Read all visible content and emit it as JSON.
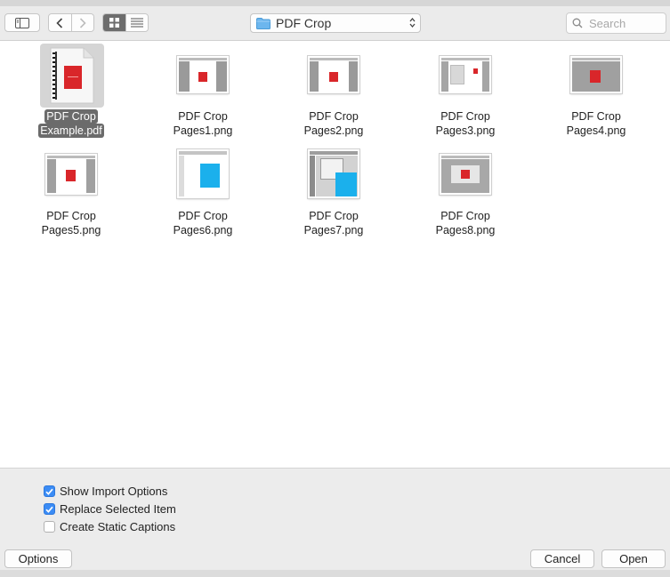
{
  "toolbar": {
    "path_folder": "PDF Crop",
    "search_placeholder": "Search"
  },
  "files": [
    {
      "line1": "PDF Crop",
      "line2": "Example.pdf",
      "selected": true
    },
    {
      "line1": "PDF Crop",
      "line2": "Pages1.png"
    },
    {
      "line1": "PDF Crop",
      "line2": "Pages2.png"
    },
    {
      "line1": "PDF Crop",
      "line2": "Pages3.png"
    },
    {
      "line1": "PDF Crop",
      "line2": "Pages4.png"
    },
    {
      "line1": "PDF Crop",
      "line2": "Pages5.png"
    },
    {
      "line1": "PDF Crop",
      "line2": "Pages6.png"
    },
    {
      "line1": "PDF Crop",
      "line2": "Pages7.png"
    },
    {
      "line1": "PDF Crop",
      "line2": "Pages8.png"
    }
  ],
  "options": [
    {
      "label": "Show Import Options",
      "checked": true
    },
    {
      "label": "Replace Selected Item",
      "checked": true
    },
    {
      "label": "Create Static Captions",
      "checked": false
    }
  ],
  "buttons": {
    "options": "Options",
    "cancel": "Cancel",
    "open": "Open"
  },
  "colors": {
    "accent": "#3b8cf5",
    "selection": "#6b6b6b",
    "folder": "#6cb6ee",
    "thumb_red": "#d9262a",
    "thumb_cyan": "#1bb0ec"
  }
}
